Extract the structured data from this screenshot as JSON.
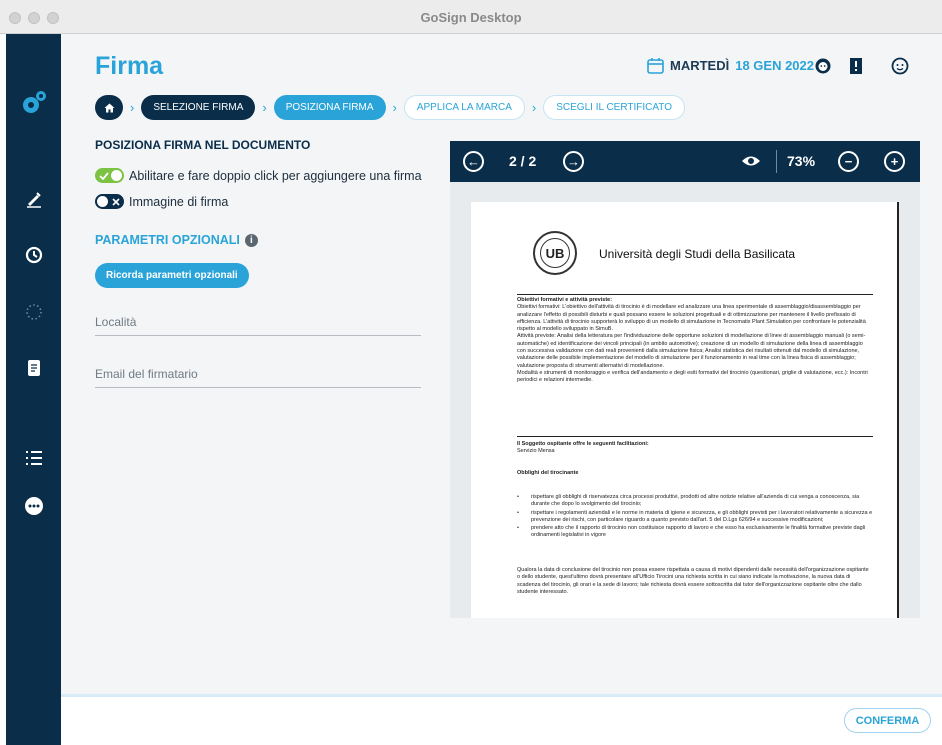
{
  "window": {
    "title": "GoSign Desktop"
  },
  "header": {
    "page_title": "Firma",
    "date_day": "MARTEDÌ",
    "date_value": "18 GEN 2022",
    "icons": [
      "calendar-icon",
      "user-support-icon",
      "manual-icon",
      "user-face-icon"
    ]
  },
  "sidebar": {
    "icons": [
      "gosign-logo-icon",
      "sign-pen-icon",
      "history-clock-icon",
      "loading-icon",
      "document-icon",
      "list-icon",
      "more-icon"
    ]
  },
  "breadcrumb": {
    "items": [
      {
        "label": "SELEZIONE FIRMA"
      },
      {
        "label": "POSIZIONA FIRMA"
      },
      {
        "label": "APPLICA LA MARCA"
      },
      {
        "label": "SCEGLI IL CERTIFICATO"
      }
    ]
  },
  "left": {
    "section_title": "POSIZIONA FIRMA NEL DOCUMENTO",
    "toggle_enable_label": "Abilitare e fare doppio click per aggiungere una firma",
    "toggle_image_label": "Immagine di firma",
    "optional_title": "PARAMETRI OPZIONALI",
    "remember_button": "Ricorda parametri opzionali",
    "location_placeholder": "Località",
    "email_placeholder": "Email del firmatario"
  },
  "viewer": {
    "page_indicator": "2 / 2",
    "zoom": "73%"
  },
  "document": {
    "university": "Università degli Studi della Basilicata",
    "logo_text": "UB",
    "objectives_heading": "Obiettivi formativi e attività previste:",
    "objectives_body": "Obiettivi formativi: L'obiettivo dell'attività di tirocinio è di modellare ed analizzare una linea sperimentale di assemblaggio/disassemblaggio per analizzare l'effetto di possibili disturbi e quali possano essere le soluzioni progettuali e di ottimizzazione per mantenere il livello prefissato di efficienza. L'attività di tirocinio supporterà lo sviluppo di un modello di simulazione in Tecnomatix Plant Simulation per confrontare le potenzialità rispetto al modello sviluppato in SimuB.",
    "activities_body": "Attività previste: Analisi della letteratura per l'individuazione delle opportune soluzioni di modellazione di linee di assemblaggio manuali (o semi-automatiche) ed identificazione dei vincoli principali (in ambito automotive); creazione di un modello di simulazione della linea di assemblaggio con successiva validazione con dati reali provenienti dalla simulazione fisica; Analisi statistica dei risultati ottenuti dal modello di simulazione, valutazione delle possibile implementazione del modello di simulazione per il funzionamento in real time con la linea fisica di assemblaggio; valutazione proposta di strumenti alternativi di modellazione.",
    "monitoring_body": "Modalità e strumenti di monitoraggio e verifica dell'andamento e degli esiti formativi del tirocinio (questionari, griglie di valutazione, ecc.): Incontri periodici e relazioni intermedie.",
    "facilities_heading": "Il Soggetto ospitante offre le seguenti facilitazioni:",
    "facilities_body": "Servizio Mensa",
    "obligations_heading": "Obblighi del tirocinante",
    "bullets": [
      "rispettare gli obblighi di riservatezza circa processi produttivi, prodotti od altre notizie relative all'azienda di cui venga a conoscenza, sia durante che dopo lo svolgimento del tirocinio;",
      "rispettare i regolamenti aziendali e le norme in materia di igiene e sicurezza, e gli obblighi previsti per i lavoratori relativamente a sicurezza e prevenzione dei rischi, con particolare riguardo a quanto previsto dall'art. 5 del D.Lgs 626/94 e successive modificazioni;",
      "prendere atto che il rapporto di tirocinio non costituisce rapporto di lavoro e che esso ha esclusivamente le finalità formative previste dagli ordinamenti legislativi in vigore"
    ],
    "bullet_mark": "•",
    "closing_body": "Qualora la data di conclusione del tirocinio non possa essere rispettata a causa di motivi dipendenti dalle necessità dell'organizzazione ospitante o dello studente, quest'ultimo dovrà presentare all'Ufficio Tirocini una richiesta scritta in cui siano indicate la motivazione, la nuova data di scadenza del tirocinio, gli orari e la sede di lavoro; tale richiesta dovrà essere sottoscritta dal tutor dell'organizzazione ospitante oltre che dallo studente interessato."
  },
  "footer": {
    "confirm_label": "CONFERMA"
  },
  "colors": {
    "accent": "#2aa4d8",
    "navy": "#0a2d4a",
    "toggle_on": "#7cc243"
  }
}
